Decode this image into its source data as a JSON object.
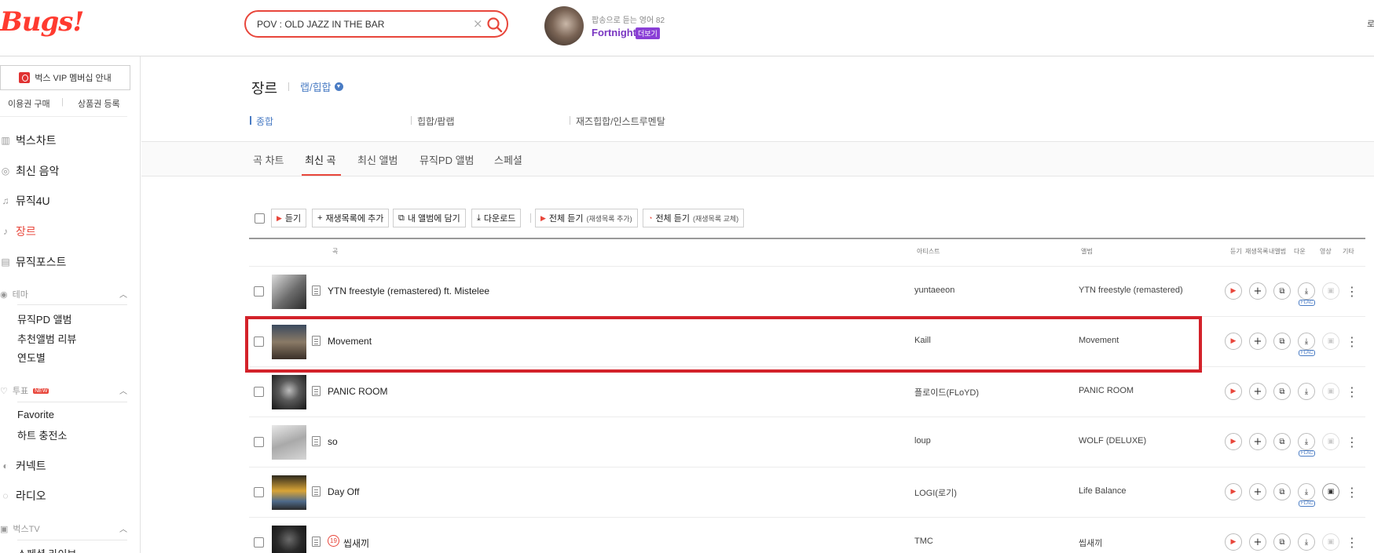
{
  "header": {
    "logo": "Bugs!",
    "search_value": "POV : OLD JAZZ IN THE BAR",
    "search_clear": "×",
    "promo_sub": "팝송으로 듣는 영어 82",
    "promo_title": "Fortnight",
    "promo_more": "더보기",
    "edge_text": "로"
  },
  "sidebar": {
    "vip_label": "벅스 VIP 멤버십 안내",
    "buy_label": "이용권 구매",
    "coupon_label": "상품권 등록",
    "items": [
      {
        "label": "벅스차트",
        "icon": "chart-icon"
      },
      {
        "label": "최신 음악",
        "icon": "new-music-icon"
      },
      {
        "label": "뮤직4U",
        "icon": "music-note-icon"
      },
      {
        "label": "장르",
        "icon": "guitar-icon"
      },
      {
        "label": "뮤직포스트",
        "icon": "post-icon"
      }
    ],
    "theme_label": "테마",
    "theme_items": [
      "뮤직PD 앨범",
      "추천앨범 리뷰",
      "연도별"
    ],
    "vote_label": "투표",
    "vote_new": "NEW",
    "vote_items": [
      "Favorite",
      "하트 충전소"
    ],
    "connect_label": "커넥트",
    "radio_label": "라디오",
    "tv_label": "벅스TV",
    "tv_cut": "스페셜 라이브"
  },
  "genre": {
    "title": "장르",
    "current": "랩/힙합",
    "subgenres": [
      "종합",
      "힙합/팝랩",
      "재즈힙합/인스트루멘탈"
    ]
  },
  "tabs": [
    "곡 차트",
    "최신 곡",
    "최신 앨범",
    "뮤직PD 앨범",
    "스페셜"
  ],
  "toolbar": {
    "listen": "듣기",
    "add_playlist": "재생목록에 추가",
    "my_album": "내 앨범에 담기",
    "download": "다운로드",
    "listen_all_add": "전체 듣기",
    "listen_all_add_small": "(재생목록 추가)",
    "listen_all_replace": "전체 듣기",
    "listen_all_replace_small": "(재생목록 교체)"
  },
  "columns": {
    "track": "곡",
    "artist": "아티스트",
    "album": "앨범",
    "listen": "듣기",
    "playlist": "재생목록",
    "myalbum": "내앨범",
    "down": "다운",
    "video": "영상",
    "etc": "기타"
  },
  "tracks": [
    {
      "title": "YTN freestyle (remastered) ft. Mistelee",
      "artist": "yuntaeeon",
      "album": "YTN freestyle (remastered)",
      "flac": "FLAC",
      "adult": false,
      "video": false
    },
    {
      "title": "Movement",
      "artist": "Kaill",
      "album": "Movement",
      "flac": "FLAC",
      "adult": false,
      "video": false
    },
    {
      "title": "PANIC ROOM",
      "artist": "플로이드(FLoYD)",
      "album": "PANIC ROOM",
      "flac": "",
      "adult": false,
      "video": false
    },
    {
      "title": "so",
      "artist": "loup",
      "album": "WOLF (DELUXE)",
      "flac": "FLAC",
      "adult": false,
      "video": false
    },
    {
      "title": "Day Off",
      "artist": "LOGI(로기)",
      "album": "Life Balance",
      "flac": "FLAC",
      "adult": false,
      "video": true
    },
    {
      "title": "씹새끼",
      "artist": "TMC",
      "album": "씹새끼",
      "flac": "",
      "adult": true,
      "adult_label": "19",
      "video": false
    }
  ],
  "colors": {
    "accent": "#e8463b",
    "link": "#4a7cc4",
    "highlight": "#d3222a",
    "promo": "#7a37c2"
  }
}
